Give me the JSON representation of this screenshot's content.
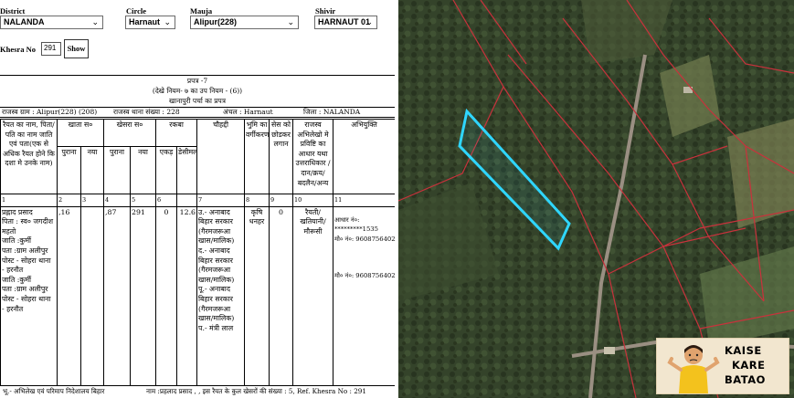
{
  "filters": {
    "district": {
      "label": "District",
      "value": "NALANDA"
    },
    "circle": {
      "label": "Circle",
      "value": "Harnaut"
    },
    "mauja": {
      "label": "Mauja",
      "value": "Alipur(228)"
    },
    "shivir": {
      "label": "Shivir",
      "value": "HARNAUT 01"
    },
    "khesra": {
      "label": "Khesra No",
      "value": "291"
    },
    "show_label": "Show"
  },
  "form": {
    "line1": "प्रपत्र -7",
    "line2": "(देखे नियम- ७ का उप नियम - (6))",
    "line3": "खानापुरी पर्चा का प्रपत्र",
    "revenue_village": "राजस्व ग्राम : Alipur(228) (208)",
    "thana": "राजस्व थाना संख्या : 228",
    "anchal": "अंचल : Harnaut",
    "zila": "जिला : NALANDA"
  },
  "table": {
    "headers": {
      "raiyat": "रैयत का नाम, पिता/ पति का नाम जाति एवं पता(एक से अधिक रैयत होने कि दशा मे उनके नाम)",
      "khata": "खाता स०",
      "khesra": "खेसरा स०",
      "rakba": "रकबा",
      "chauhaddi": "चौहद्दी",
      "bhumi": "भुमि का वर्गीकरण",
      "ses": "सेस को छोडकर लगान",
      "rajasv": "राजस्व अभिलेखो मे प्रविष्टि का आधार यथा उत्तराधिकार /दान/क्रय/ बदलैन/अन्य",
      "abhiyukti": "अभियुक्ति",
      "purana": "पुराना",
      "naya": "नया",
      "acre": "एकड़",
      "decimal": "डेसीमल"
    },
    "col_numbers": [
      "1",
      "2",
      "3",
      "4",
      "5",
      "6",
      "",
      "7",
      "8",
      "9",
      "10",
      "11"
    ],
    "row": {
      "raiyat_lines": [
        "प्रह्लाद प्रसाद",
        "पिता : स्व० जगदीश",
        "महतो",
        "जाति :कुर्मी",
        "पता :ग्राम अलीपुर",
        "पोस्ट - सोहरा थाना",
        "- हरनौत",
        "जाति :कुर्मी",
        "पता :ग्राम अलीपुर",
        "पोस्ट - सोहरा थाना",
        "- हरनौत"
      ],
      "khata_purana": ",16",
      "khata_naya": "",
      "khesra_purana": ",87",
      "khesra_naya": "291",
      "acre": "0",
      "decimal": "12.6",
      "chauhaddi_lines": [
        "उ.- अनाबाद",
        "बिहार सरकार",
        "(गैरमजरूआ",
        "खास/मालिक)",
        "द.- अनाबाद",
        "बिहार सरकार",
        "(गैरमजरूआ",
        "खास/मालिक)",
        "पू.- अनाबाद",
        "बिहार सरकार",
        "(गैरमजरूआ",
        "खास/मालिक)",
        "प.- मंत्री लाल"
      ],
      "bhumi_lines": [
        "कृषि",
        "धनहर"
      ],
      "ses": "0",
      "rajasv_lines": [
        "रैयती/",
        "खतियानी/",
        "मौरूसी"
      ],
      "abhiyukti_lines": [
        "आधार नं०:",
        "*********1535",
        "मो० नं०: 9608756402",
        "",
        "मो० नं०: 9608756402"
      ]
    }
  },
  "footer": {
    "left": "भू.- अभिलेख एवं परिमाप निदेशालय बिहार",
    "right": "नाम :प्रहलाद प्रसाद , , इस रैयत के कुल खेसरों की संख्या : 5, Ref. Khesra No : 291"
  },
  "logo": {
    "line1": "KAISE",
    "line2": "KARE",
    "line3": "BATAO"
  },
  "colors": {
    "parcel_highlight": "#2fd6ff",
    "boundary_lines": "#c8323c",
    "road": "#9a8f82",
    "map_base": "#37452a",
    "logo_bg": "#f2e6cf"
  }
}
